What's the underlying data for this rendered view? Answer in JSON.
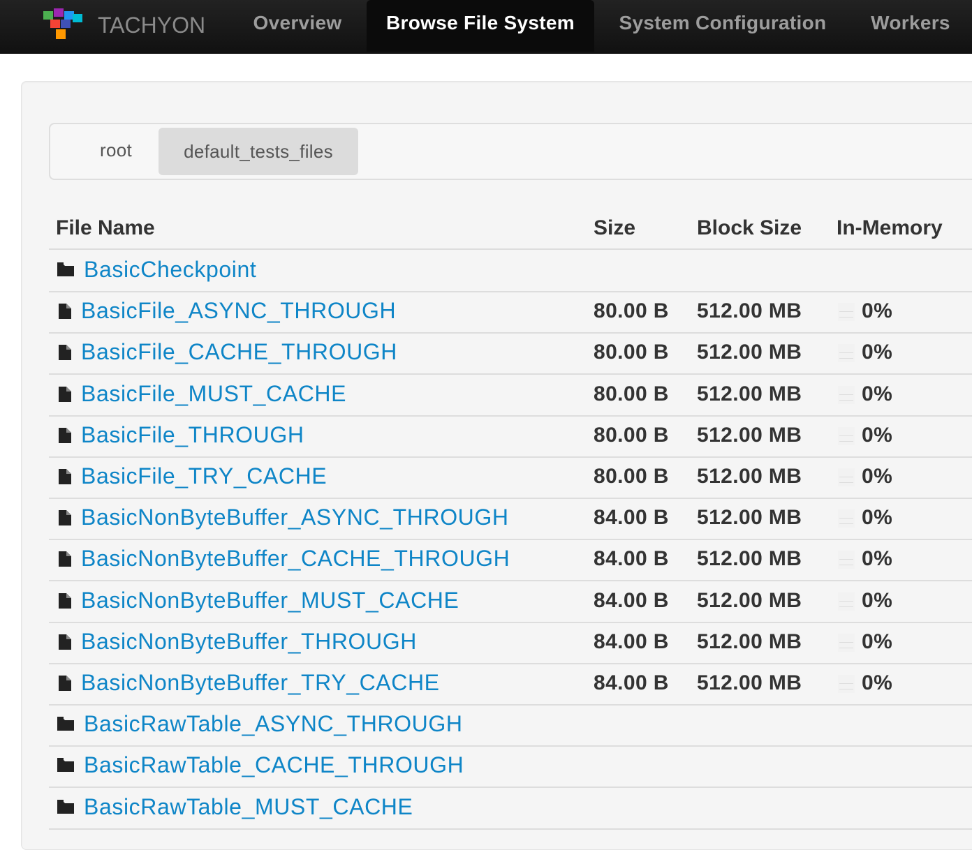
{
  "navbar": {
    "brand": "TACHYON",
    "items": [
      {
        "label": "Overview"
      },
      {
        "label": "Browse File System",
        "active": true
      },
      {
        "label": "System Configuration"
      },
      {
        "label": "Workers"
      }
    ]
  },
  "breadcrumb": {
    "items": [
      {
        "label": "root"
      },
      {
        "label": "default_tests_files",
        "active": true
      }
    ]
  },
  "table": {
    "headers": {
      "name": "File Name",
      "size": "Size",
      "block_size": "Block Size",
      "in_memory": "In-Memory"
    },
    "rows": [
      {
        "type": "folder",
        "name": "BasicCheckpoint",
        "size": "",
        "block_size": "",
        "in_memory": ""
      },
      {
        "type": "file",
        "name": "BasicFile_ASYNC_THROUGH",
        "size": "80.00 B",
        "block_size": "512.00 MB",
        "in_memory": "0%"
      },
      {
        "type": "file",
        "name": "BasicFile_CACHE_THROUGH",
        "size": "80.00 B",
        "block_size": "512.00 MB",
        "in_memory": "0%"
      },
      {
        "type": "file",
        "name": "BasicFile_MUST_CACHE",
        "size": "80.00 B",
        "block_size": "512.00 MB",
        "in_memory": "0%"
      },
      {
        "type": "file",
        "name": "BasicFile_THROUGH",
        "size": "80.00 B",
        "block_size": "512.00 MB",
        "in_memory": "0%"
      },
      {
        "type": "file",
        "name": "BasicFile_TRY_CACHE",
        "size": "80.00 B",
        "block_size": "512.00 MB",
        "in_memory": "0%"
      },
      {
        "type": "file",
        "name": "BasicNonByteBuffer_ASYNC_THROUGH",
        "size": "84.00 B",
        "block_size": "512.00 MB",
        "in_memory": "0%"
      },
      {
        "type": "file",
        "name": "BasicNonByteBuffer_CACHE_THROUGH",
        "size": "84.00 B",
        "block_size": "512.00 MB",
        "in_memory": "0%"
      },
      {
        "type": "file",
        "name": "BasicNonByteBuffer_MUST_CACHE",
        "size": "84.00 B",
        "block_size": "512.00 MB",
        "in_memory": "0%"
      },
      {
        "type": "file",
        "name": "BasicNonByteBuffer_THROUGH",
        "size": "84.00 B",
        "block_size": "512.00 MB",
        "in_memory": "0%"
      },
      {
        "type": "file",
        "name": "BasicNonByteBuffer_TRY_CACHE",
        "size": "84.00 B",
        "block_size": "512.00 MB",
        "in_memory": "0%"
      },
      {
        "type": "folder",
        "name": "BasicRawTable_ASYNC_THROUGH",
        "size": "",
        "block_size": "",
        "in_memory": ""
      },
      {
        "type": "folder",
        "name": "BasicRawTable_CACHE_THROUGH",
        "size": "",
        "block_size": "",
        "in_memory": ""
      },
      {
        "type": "folder",
        "name": "BasicRawTable_MUST_CACHE",
        "size": "",
        "block_size": "",
        "in_memory": ""
      }
    ]
  },
  "colors": {
    "link": "#0e85c7",
    "navbar_bg": "#1b1b1b",
    "nav_text": "#9d9d9d",
    "nav_active_text": "#ffffff"
  },
  "icons": {
    "folder": "folder-icon",
    "file": "file-icon",
    "in_memory": "memory-bar-icon",
    "logo": "tachyon-logo-icon"
  }
}
